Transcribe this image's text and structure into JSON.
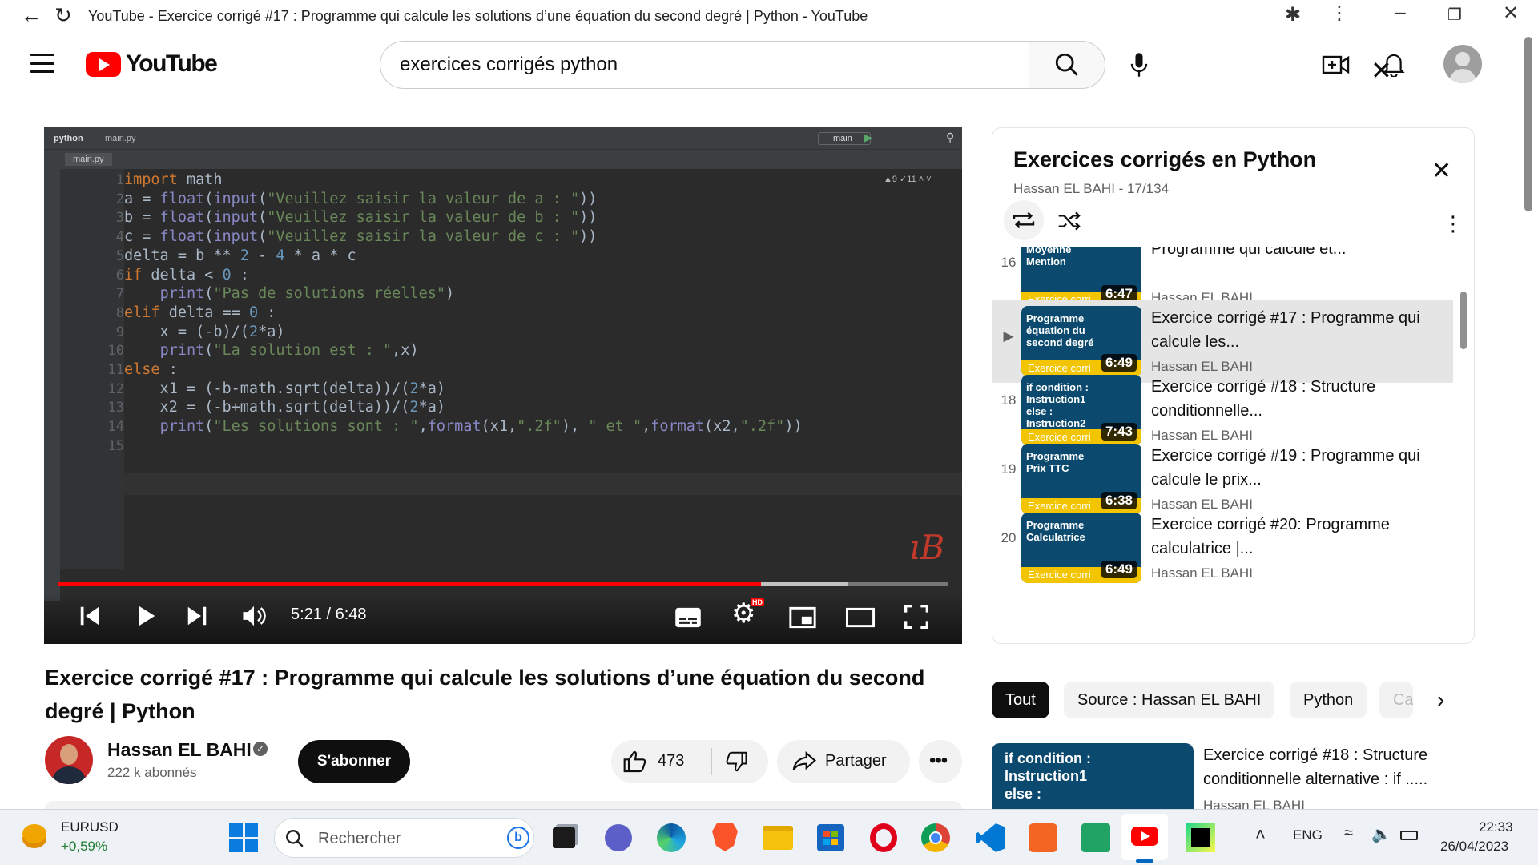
{
  "window": {
    "title": "YouTube - Exercice corrigé #17 : Programme qui calcule les solutions d’une équation du second degré | Python - YouTube"
  },
  "header": {
    "logo_text": "YouTube",
    "search_value": "exercices corrigés python"
  },
  "player": {
    "ide_project": "python",
    "ide_file": "main.py",
    "ide_branch": "main",
    "code_lines": [
      "import math",
      "a = float(input(\"Veuillez saisir la valeur de a : \"))",
      "b = float(input(\"Veuillez saisir la valeur de b : \"))",
      "c = float(input(\"Veuillez saisir la valeur de c : \"))",
      "delta = b ** 2 - 4 * a * c",
      "if delta < 0 :",
      "    print(\"Pas de solutions réelles\")",
      "elif delta == 0 :",
      "    x = (-b)/(2*a)",
      "    print(\"La solution est : \",x)",
      "else :",
      "    x1 = (-b-math.sqrt(delta))/(2*a)",
      "    x2 = (-b+math.sqrt(delta))/(2*a)",
      "    print(\"Les solutions sont : \",format(x1,\".2f\"), \" et \",format(x2,\".2f\"))",
      ""
    ],
    "time": "5:21 / 6:48",
    "progress": 0.79,
    "hd_badge": "HD",
    "watermark": "ıB"
  },
  "playlist": {
    "title": "Exercices corrigés en Python",
    "subtitle": "Hassan EL BAHI - 17/134",
    "items": [
      {
        "index": "16",
        "thumb": "Moyenne Mention",
        "band": "Exercice corri",
        "duration": "6:47",
        "title": "Programme qui calcule et...",
        "channel": "Hassan EL BAHI"
      },
      {
        "index": "▶",
        "thumb": "Programme équation du second degré",
        "band": "Exercice corri",
        "duration": "6:49",
        "title": "Exercice corrigé #17 : Programme qui calcule les...",
        "channel": "Hassan EL BAHI"
      },
      {
        "index": "18",
        "thumb": "if condition : Instruction1 else : Instruction2",
        "band": "Exercice corri",
        "duration": "7:43",
        "title": "Exercice corrigé #18 : Structure conditionnelle...",
        "channel": "Hassan EL BAHI"
      },
      {
        "index": "19",
        "thumb": "Programme Prix TTC",
        "band": "Exercice corri",
        "duration": "6:38",
        "title": "Exercice corrigé #19 : Programme qui calcule le prix...",
        "channel": "Hassan EL BAHI"
      },
      {
        "index": "20",
        "thumb": "Programme Calculatrice",
        "band": "Exercice corri",
        "duration": "6:49",
        "title": "Exercice corrigé #20: Programme calculatrice |...",
        "channel": "Hassan EL BAHI"
      }
    ]
  },
  "chips": [
    "Tout",
    "Source : Hassan EL BAHI",
    "Python",
    "Ca"
  ],
  "video": {
    "title": "Exercice corrigé #17 : Programme qui calcule les solutions d’une équation du second degré | Python",
    "channel": "Hassan EL BAHI",
    "subscribers": "222 k abonnés",
    "subscribe_label": "S'abonner",
    "likes": "473",
    "share_label": "Partager"
  },
  "recommendation": {
    "thumb": "if condition : Instruction1 else :",
    "title": "Exercice corrigé #18 : Structure conditionnelle alternative : if .....",
    "channel": "Hassan EL BAHI"
  },
  "taskbar": {
    "ticker": "EURUSD",
    "ticker_change": "+0,59%",
    "search_placeholder": "Rechercher",
    "lang": "ENG",
    "time": "22:33",
    "date": "26/04/2023"
  }
}
